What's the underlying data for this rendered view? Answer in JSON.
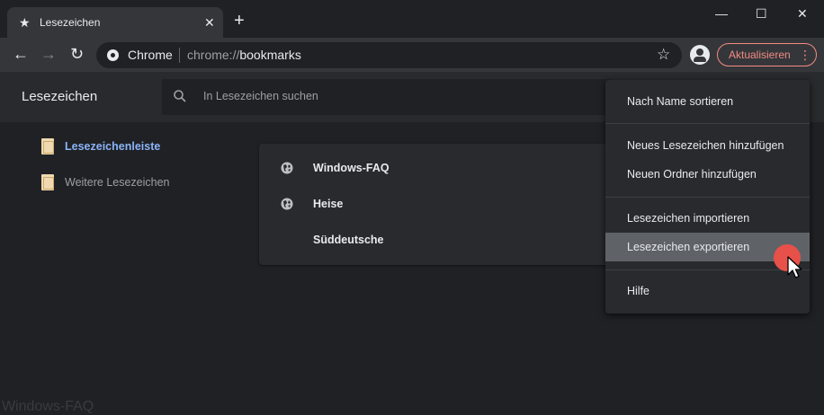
{
  "window": {
    "tab_title": "Lesezeichen",
    "tab_star": "★",
    "tab_close": "✕",
    "new_tab": "+",
    "minimize": "—",
    "maximize": "☐",
    "close": "✕"
  },
  "toolbar": {
    "back": "←",
    "forward": "→",
    "reload": "↻",
    "site_name": "Chrome",
    "url_scheme": "chrome://",
    "url_host": "bookmarks",
    "bookmark_star": "☆",
    "update_label": "Aktualisieren",
    "update_menu": "⋮",
    "update_accent": "#f28b82"
  },
  "header": {
    "title": "Lesezeichen",
    "search_placeholder": "In Lesezeichen suchen"
  },
  "tree": [
    {
      "label": "Lesezeichenleiste",
      "active": true
    },
    {
      "label": "Weitere Lesezeichen",
      "active": false
    }
  ],
  "bookmarks": [
    {
      "title": "Windows-FAQ",
      "icon": "globe-icon"
    },
    {
      "title": "Heise",
      "icon": "globe-icon"
    },
    {
      "title": "Süddeutsche",
      "icon": "none"
    }
  ],
  "organize_menu": {
    "sort": "Nach Name sortieren",
    "add_bookmark": "Neues Lesezeichen hinzufügen",
    "add_folder": "Neuen Ordner hinzufügen",
    "import": "Lesezeichen importieren",
    "export": "Lesezeichen exportieren",
    "help": "Hilfe",
    "hovered_item": "export"
  },
  "colors": {
    "background": "#202124",
    "active_link": "#8ab4f8",
    "click_indicator": "#e8504a"
  },
  "watermark": "Windows-FAQ"
}
